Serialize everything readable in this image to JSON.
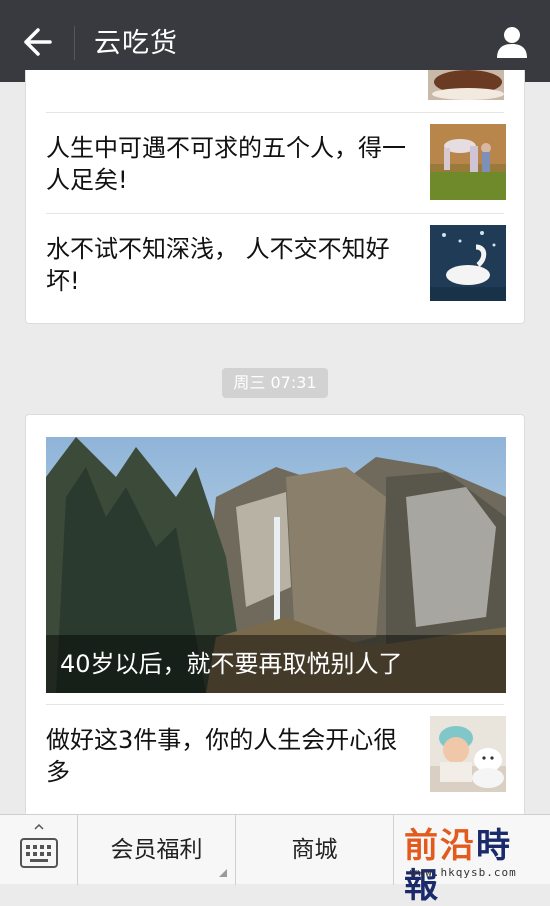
{
  "header": {
    "title": "云吃货",
    "back_icon": "arrow-left-icon",
    "profile_icon": "user-icon"
  },
  "articles_top": [
    {
      "title": "人生中可遇不可求的五个人，得一人足矣!",
      "thumb_icon": "woman-field-photo"
    },
    {
      "title": "水不试不知深浅， 人不交不知好坏!",
      "thumb_icon": "swan-photo"
    }
  ],
  "timestamp": "周三 07:31",
  "featured": {
    "title": "40岁以后，就不要再取悦别人了",
    "image": "mountain-waterfall-photo"
  },
  "articles_bottom": [
    {
      "title": "做好这3件事，你的人生会开心很多",
      "thumb_icon": "child-dog-photo"
    }
  ],
  "bottom_menu": {
    "keyboard_icon": "keyboard-icon",
    "items": [
      "会员福利",
      "商城",
      ""
    ]
  },
  "watermark": {
    "part1": "前沿",
    "part2": "時報",
    "url": "www.hkqysb.com"
  },
  "colors": {
    "topbar": "#393a3f",
    "background": "#ebebeb",
    "watermark_orange": "#e25a1c",
    "watermark_navy": "#1b2a6b"
  }
}
